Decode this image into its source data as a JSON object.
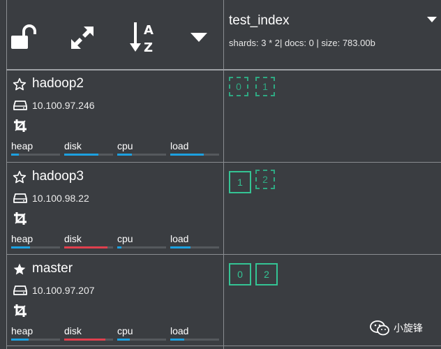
{
  "toolbar": {
    "icons": [
      "unlock-icon",
      "expand-icon",
      "sort-alpha-icon",
      "caret-down-icon"
    ],
    "sort_letters": [
      "A",
      "Z"
    ]
  },
  "index": {
    "name": "test_index",
    "meta": "shards: 3 * 2| docs: 0 | size: 783.00b"
  },
  "nodes": [
    {
      "name": "hadoop2",
      "ip": "10.100.97.246",
      "master": false,
      "metrics": [
        {
          "label": "heap",
          "level": 0.16,
          "color": "#1da1e0"
        },
        {
          "label": "disk",
          "level": 0.7,
          "color": "#1da1e0"
        },
        {
          "label": "cpu",
          "level": 0.3,
          "color": "#1da1e0"
        },
        {
          "label": "load",
          "level": 0.68,
          "color": "#1da1e0"
        }
      ],
      "shards": [
        {
          "label": "0",
          "kind": "replica"
        },
        {
          "label": "1",
          "kind": "replica"
        }
      ]
    },
    {
      "name": "hadoop3",
      "ip": "10.100.98.22",
      "master": false,
      "metrics": [
        {
          "label": "heap",
          "level": 0.38,
          "color": "#1da1e0"
        },
        {
          "label": "disk",
          "level": 0.88,
          "color": "#e0404e"
        },
        {
          "label": "cpu",
          "level": 0.08,
          "color": "#1da1e0"
        },
        {
          "label": "load",
          "level": 0.42,
          "color": "#1da1e0"
        }
      ],
      "shards": [
        {
          "label": "1",
          "kind": "primary"
        },
        {
          "label": "2",
          "kind": "replica"
        }
      ]
    },
    {
      "name": "master",
      "ip": "10.100.97.207",
      "master": true,
      "metrics": [
        {
          "label": "heap",
          "level": 0.36,
          "color": "#1da1e0"
        },
        {
          "label": "disk",
          "level": 0.84,
          "color": "#e0404e"
        },
        {
          "label": "cpu",
          "level": 0.26,
          "color": "#1da1e0"
        },
        {
          "label": "load",
          "level": 0.28,
          "color": "#1da1e0"
        }
      ],
      "shards": [
        {
          "label": "0",
          "kind": "primary"
        },
        {
          "label": "2",
          "kind": "primary"
        }
      ]
    }
  ],
  "watermark": {
    "text": "小旋锋",
    "icon": "wechat-icon"
  }
}
